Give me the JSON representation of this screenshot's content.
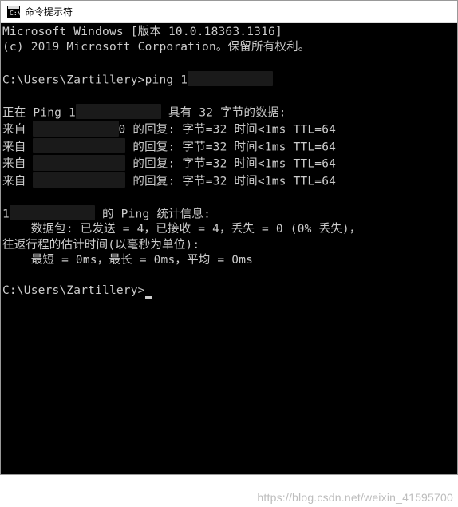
{
  "titlebar": {
    "title": "命令提示符"
  },
  "terminal": {
    "header_line1": "Microsoft Windows [版本 10.0.18363.1316]",
    "header_line2": "(c) 2019 Microsoft Corporation。保留所有权利。",
    "prompt1_path": "C:\\Users\\Zartillery>",
    "prompt1_cmd": "ping ",
    "prompt1_ip_visible": "1",
    "pinging_prefix": "正在 Ping 1",
    "pinging_suffix": " 具有 32 字节的数据:",
    "reply_prefix": "来自 ",
    "reply_visible_ip_last": "0",
    "reply_suffix": " 的回复: 字节=32 时间<1ms TTL=64",
    "stats_header_prefix": "1",
    "stats_header_suffix": " 的 Ping 统计信息:",
    "stats_packets": "    数据包: 已发送 = 4，已接收 = 4，丢失 = 0 (0% 丢失)，",
    "stats_rtt_header": "往返行程的估计时间(以毫秒为单位):",
    "stats_rtt_values": "    最短 = 0ms，最长 = 0ms，平均 = 0ms",
    "prompt2_path": "C:\\Users\\Zartillery>"
  },
  "watermark": {
    "text": "https://blog.csdn.net/weixin_41595700"
  }
}
